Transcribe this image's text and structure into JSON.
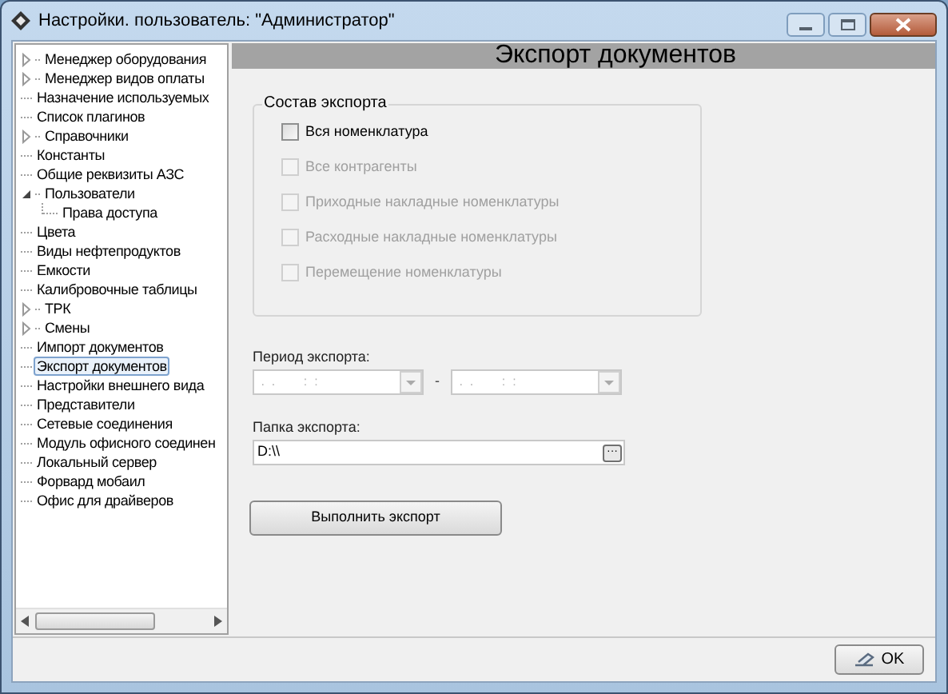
{
  "window": {
    "title": "Настройки. пользователь: \"Администратор\""
  },
  "tree": {
    "items": [
      {
        "label": "Менеджер оборудования",
        "kind": "branch",
        "expanded": false,
        "selected": false
      },
      {
        "label": "Менеджер видов оплаты",
        "kind": "branch",
        "expanded": false,
        "selected": false
      },
      {
        "label": "Назначение используемых",
        "kind": "leaf",
        "selected": false
      },
      {
        "label": "Список плагинов",
        "kind": "leaf",
        "selected": false
      },
      {
        "label": "Справочники",
        "kind": "branch",
        "expanded": false,
        "selected": false
      },
      {
        "label": "Константы",
        "kind": "leaf",
        "selected": false
      },
      {
        "label": "Общие реквизиты АЗС",
        "kind": "leaf",
        "selected": false
      },
      {
        "label": "Пользователи",
        "kind": "branch",
        "expanded": true,
        "selected": false,
        "children": [
          {
            "label": "Права доступа",
            "kind": "leaf",
            "selected": false
          }
        ]
      },
      {
        "label": "Цвета",
        "kind": "leaf",
        "selected": false
      },
      {
        "label": "Виды нефтепродуктов",
        "kind": "leaf",
        "selected": false
      },
      {
        "label": "Емкости",
        "kind": "leaf",
        "selected": false
      },
      {
        "label": "Калибровочные таблицы",
        "kind": "leaf",
        "selected": false
      },
      {
        "label": "ТРК",
        "kind": "branch",
        "expanded": false,
        "selected": false
      },
      {
        "label": "Смены",
        "kind": "branch",
        "expanded": false,
        "selected": false
      },
      {
        "label": "Импорт документов",
        "kind": "leaf",
        "selected": false
      },
      {
        "label": "Экспорт документов",
        "kind": "leaf",
        "selected": true
      },
      {
        "label": "Настройки внешнего вида",
        "kind": "leaf",
        "selected": false
      },
      {
        "label": "Представители",
        "kind": "leaf",
        "selected": false
      },
      {
        "label": "Сетевые соединения",
        "kind": "leaf",
        "selected": false
      },
      {
        "label": "Модуль офисного соединен",
        "kind": "leaf",
        "selected": false
      },
      {
        "label": "Локальный сервер",
        "kind": "leaf",
        "selected": false
      },
      {
        "label": "Форвард мобаил",
        "kind": "leaf",
        "selected": false
      },
      {
        "label": "Офис для драйверов",
        "kind": "leaf",
        "selected": false
      }
    ]
  },
  "panel": {
    "title": "Экспорт документов",
    "group": {
      "title": "Состав экспорта",
      "checkboxes": [
        {
          "label": "Вся номенклатура",
          "checked": false,
          "disabled": false
        },
        {
          "label": "Все контрагенты",
          "checked": false,
          "disabled": true
        },
        {
          "label": "Приходные накладные номенклатуры",
          "checked": false,
          "disabled": true
        },
        {
          "label": "Расходные накладные номенклатуры",
          "checked": false,
          "disabled": true
        },
        {
          "label": "Перемещение номенклатуры",
          "checked": false,
          "disabled": true
        }
      ]
    },
    "period": {
      "label": "Период экспорта:",
      "from": " .  .        :  :",
      "separator": "-",
      "to": " .  .        :  :"
    },
    "folder": {
      "label": "Папка экспорта:",
      "value": "D:\\\\",
      "browse": "···"
    },
    "run_button": "Выполнить экспорт"
  },
  "footer": {
    "ok_button": "OK"
  }
}
